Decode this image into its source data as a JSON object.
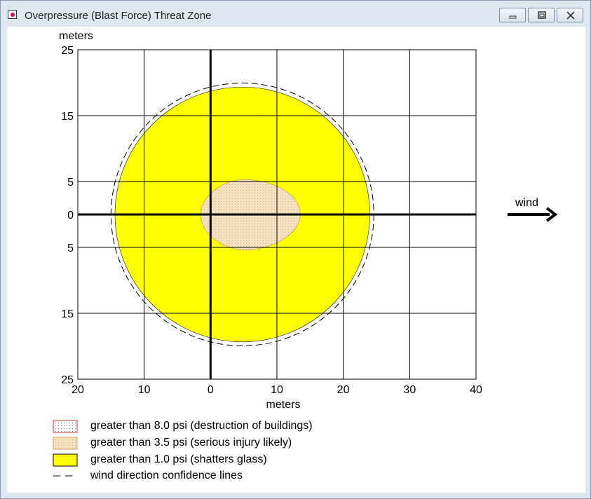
{
  "window": {
    "title": "Overpressure (Blast Force) Threat Zone",
    "buttons": [
      "minimize",
      "maximize",
      "close"
    ]
  },
  "chart_data": {
    "type": "area",
    "ylabel": "meters",
    "xlabel": "meters",
    "xlim": [
      -20,
      40
    ],
    "ylim": [
      -25,
      25
    ],
    "x_ticks": [
      "20",
      "10",
      "0",
      "10",
      "20",
      "30",
      "40"
    ],
    "y_ticks": [
      "25",
      "15",
      "5",
      "0",
      "5",
      "15",
      "25"
    ],
    "x_tick_values": [
      -20,
      -10,
      0,
      10,
      20,
      30,
      40
    ],
    "y_tick_values": [
      25,
      15,
      5,
      0,
      -5,
      -15,
      -25
    ],
    "grid": true,
    "zones": [
      {
        "name": "greater than 1.0 psi (shatters glass)",
        "shape": "circle",
        "center": [
          4.8,
          0
        ],
        "radius": 19.2,
        "color": "#ffff00"
      },
      {
        "name": "greater than 3.5 psi (serious injury likely)",
        "shape": "blob",
        "center": [
          5.0,
          0
        ],
        "approx_extent_x": [
          -1.5,
          13.5
        ],
        "approx_extent_y": [
          -5.3,
          5.3
        ],
        "color": "#f5deb3",
        "pattern": "dotted"
      },
      {
        "name": "greater than 8.0 psi (destruction of buildings)",
        "color": "#ffffff",
        "pattern": "red-dotted"
      },
      {
        "name": "wind direction confidence lines",
        "shape": "circle",
        "center": [
          4.8,
          0
        ],
        "radius": 19.8,
        "style": "dashed"
      }
    ],
    "wind_label": "wind",
    "wind_direction": "east"
  },
  "legend": [
    {
      "label": "greater than 8.0 psi (destruction of buildings)"
    },
    {
      "label": "greater than 3.5 psi (serious injury likely)"
    },
    {
      "label": "greater than 1.0 psi (shatters glass)"
    },
    {
      "label": "wind direction confidence lines"
    }
  ]
}
